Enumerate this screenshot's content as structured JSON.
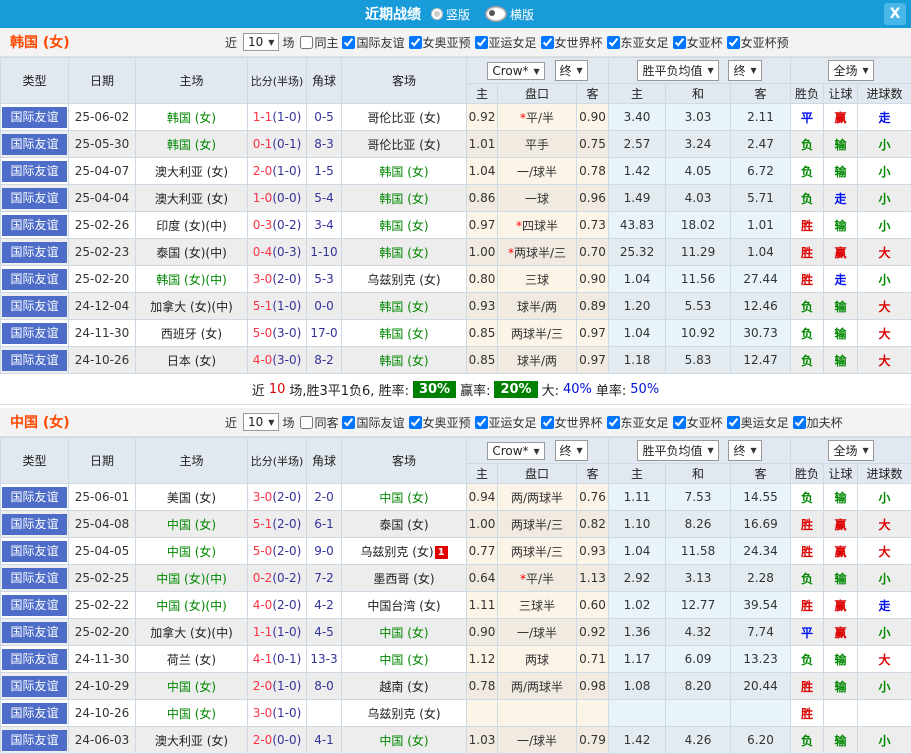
{
  "titlebar": {
    "title": "近期战绩",
    "radio_options": [
      {
        "label": "竖版",
        "selected": false
      },
      {
        "label": "横版",
        "selected": true
      }
    ],
    "close_label": "X"
  },
  "table_header": {
    "type": "类型",
    "date": "日期",
    "home": "主场",
    "score": "比分(半场)",
    "corner": "角球",
    "away": "客场",
    "odds_dropdown": "Crow*",
    "odds_final": "终",
    "avg_dropdown": "胜平负均值",
    "avg_final": "终",
    "full_dropdown": "全场",
    "sub": {
      "home_odd": "主",
      "handicap": "盘口",
      "away_odd": "客",
      "avg_home": "主",
      "avg_draw": "和",
      "avg_away": "客",
      "result": "胜负",
      "handicap_result": "让球",
      "goals": "进球数"
    }
  },
  "sections": [
    {
      "team_title": "韩国 (女)",
      "team_key": "韩国 (女)",
      "near_label": "近",
      "games": "10",
      "games_unit": "场",
      "same_label": "同主",
      "same_checked": false,
      "filters": [
        "国际友谊",
        "女奥亚预",
        "亚运女足",
        "女世界杯",
        "东亚女足",
        "女亚杯",
        "女亚杯预"
      ],
      "rows": [
        {
          "type": "国际友谊",
          "date": "25-06-02",
          "home": "韩国 (女)",
          "score": "1-1",
          "half": "(1-0)",
          "corner": "0-5",
          "away": "哥伦比亚 (女)",
          "badge": "",
          "oh": "0.92",
          "star": "*",
          "hand": "平/半",
          "oa": "0.90",
          "ah": "3.40",
          "ad": "3.03",
          "aa": "2.11",
          "r1": "平",
          "r2": "赢",
          "r3": "走"
        },
        {
          "type": "国际友谊",
          "date": "25-05-30",
          "home": "韩国 (女)",
          "score": "0-1",
          "half": "(0-1)",
          "corner": "8-3",
          "away": "哥伦比亚 (女)",
          "badge": "",
          "oh": "1.01",
          "star": "",
          "hand": "平手",
          "oa": "0.75",
          "ah": "2.57",
          "ad": "3.24",
          "aa": "2.47",
          "r1": "负",
          "r2": "输",
          "r3": "小"
        },
        {
          "type": "国际友谊",
          "date": "25-04-07",
          "home": "澳大利亚 (女)",
          "score": "2-0",
          "half": "(1-0)",
          "corner": "1-5",
          "away": "韩国 (女)",
          "badge": "",
          "oh": "1.04",
          "star": "",
          "hand": "一/球半",
          "oa": "0.78",
          "ah": "1.42",
          "ad": "4.05",
          "aa": "6.72",
          "r1": "负",
          "r2": "输",
          "r3": "小"
        },
        {
          "type": "国际友谊",
          "date": "25-04-04",
          "home": "澳大利亚 (女)",
          "score": "1-0",
          "half": "(0-0)",
          "corner": "5-4",
          "away": "韩国 (女)",
          "badge": "",
          "oh": "0.86",
          "star": "",
          "hand": "一球",
          "oa": "0.96",
          "ah": "1.49",
          "ad": "4.03",
          "aa": "5.71",
          "r1": "负",
          "r2": "走",
          "r3": "小"
        },
        {
          "type": "国际友谊",
          "date": "25-02-26",
          "home": "印度 (女)(中)",
          "score": "0-3",
          "half": "(0-2)",
          "corner": "3-4",
          "away": "韩国 (女)",
          "badge": "",
          "oh": "0.97",
          "star": "*",
          "hand": "四球半",
          "oa": "0.73",
          "ah": "43.83",
          "ad": "18.02",
          "aa": "1.01",
          "r1": "胜",
          "r2": "输",
          "r3": "小"
        },
        {
          "type": "国际友谊",
          "date": "25-02-23",
          "home": "泰国 (女)(中)",
          "score": "0-4",
          "half": "(0-3)",
          "corner": "1-10",
          "away": "韩国 (女)",
          "badge": "",
          "oh": "1.00",
          "star": "*",
          "hand": "两球半/三",
          "oa": "0.70",
          "ah": "25.32",
          "ad": "11.29",
          "aa": "1.04",
          "r1": "胜",
          "r2": "赢",
          "r3": "大"
        },
        {
          "type": "国际友谊",
          "date": "25-02-20",
          "home": "韩国 (女)(中)",
          "score": "3-0",
          "half": "(2-0)",
          "corner": "5-3",
          "away": "乌兹别克 (女)",
          "badge": "",
          "oh": "0.80",
          "star": "",
          "hand": "三球",
          "oa": "0.90",
          "ah": "1.04",
          "ad": "11.56",
          "aa": "27.44",
          "r1": "胜",
          "r2": "走",
          "r3": "小"
        },
        {
          "type": "国际友谊",
          "date": "24-12-04",
          "home": "加拿大 (女)(中)",
          "score": "5-1",
          "half": "(1-0)",
          "corner": "0-0",
          "away": "韩国 (女)",
          "badge": "",
          "oh": "0.93",
          "star": "",
          "hand": "球半/两",
          "oa": "0.89",
          "ah": "1.20",
          "ad": "5.53",
          "aa": "12.46",
          "r1": "负",
          "r2": "输",
          "r3": "大"
        },
        {
          "type": "国际友谊",
          "date": "24-11-30",
          "home": "西班牙 (女)",
          "score": "5-0",
          "half": "(3-0)",
          "corner": "17-0",
          "away": "韩国 (女)",
          "badge": "",
          "oh": "0.85",
          "star": "",
          "hand": "两球半/三",
          "oa": "0.97",
          "ah": "1.04",
          "ad": "10.92",
          "aa": "30.73",
          "r1": "负",
          "r2": "输",
          "r3": "大"
        },
        {
          "type": "国际友谊",
          "date": "24-10-26",
          "home": "日本 (女)",
          "score": "4-0",
          "half": "(3-0)",
          "corner": "8-2",
          "away": "韩国 (女)",
          "badge": "",
          "oh": "0.85",
          "star": "",
          "hand": "球半/两",
          "oa": "0.97",
          "ah": "1.18",
          "ad": "5.83",
          "aa": "12.47",
          "r1": "负",
          "r2": "输",
          "r3": "大"
        }
      ],
      "summary": {
        "prefix": "近",
        "count": "10",
        "mid": "场,胜3平1负6, 胜率:",
        "rate1": "30%",
        "label2": "赢率:",
        "rate2": "20%",
        "label3": "大:",
        "rate3": "40%",
        "label4": "单率:",
        "rate4": "50%"
      }
    },
    {
      "team_title": "中国 (女)",
      "team_key": "中国 (女)",
      "near_label": "近",
      "games": "10",
      "games_unit": "场",
      "same_label": "同客",
      "same_checked": false,
      "filters": [
        "国际友谊",
        "女奥亚预",
        "亚运女足",
        "女世界杯",
        "东亚女足",
        "女亚杯",
        "奥运女足",
        "加夫杯"
      ],
      "rows": [
        {
          "type": "国际友谊",
          "date": "25-06-01",
          "home": "美国 (女)",
          "score": "3-0",
          "half": "(2-0)",
          "corner": "2-0",
          "away": "中国 (女)",
          "badge": "",
          "oh": "0.94",
          "star": "",
          "hand": "两/两球半",
          "oa": "0.76",
          "ah": "1.11",
          "ad": "7.53",
          "aa": "14.55",
          "r1": "负",
          "r2": "输",
          "r3": "小"
        },
        {
          "type": "国际友谊",
          "date": "25-04-08",
          "home": "中国 (女)",
          "score": "5-1",
          "half": "(2-0)",
          "corner": "6-1",
          "away": "泰国 (女)",
          "badge": "",
          "oh": "1.00",
          "star": "",
          "hand": "两球半/三",
          "oa": "0.82",
          "ah": "1.10",
          "ad": "8.26",
          "aa": "16.69",
          "r1": "胜",
          "r2": "赢",
          "r3": "大"
        },
        {
          "type": "国际友谊",
          "date": "25-04-05",
          "home": "中国 (女)",
          "score": "5-0",
          "half": "(2-0)",
          "corner": "9-0",
          "away": "乌兹别克 (女)",
          "badge": "1",
          "oh": "0.77",
          "star": "",
          "hand": "两球半/三",
          "oa": "0.93",
          "ah": "1.04",
          "ad": "11.58",
          "aa": "24.34",
          "r1": "胜",
          "r2": "赢",
          "r3": "大"
        },
        {
          "type": "国际友谊",
          "date": "25-02-25",
          "home": "中国 (女)(中)",
          "score": "0-2",
          "half": "(0-2)",
          "corner": "7-2",
          "away": "墨西哥 (女)",
          "badge": "",
          "oh": "0.64",
          "star": "*",
          "hand": "平/半",
          "oa": "1.13",
          "ah": "2.92",
          "ad": "3.13",
          "aa": "2.28",
          "r1": "负",
          "r2": "输",
          "r3": "小"
        },
        {
          "type": "国际友谊",
          "date": "25-02-22",
          "home": "中国 (女)(中)",
          "score": "4-0",
          "half": "(2-0)",
          "corner": "4-2",
          "away": "中国台湾 (女)",
          "badge": "",
          "oh": "1.11",
          "star": "",
          "hand": "三球半",
          "oa": "0.60",
          "ah": "1.02",
          "ad": "12.77",
          "aa": "39.54",
          "r1": "胜",
          "r2": "赢",
          "r3": "走"
        },
        {
          "type": "国际友谊",
          "date": "25-02-20",
          "home": "加拿大 (女)(中)",
          "score": "1-1",
          "half": "(1-0)",
          "corner": "4-5",
          "away": "中国 (女)",
          "badge": "",
          "oh": "0.90",
          "star": "",
          "hand": "一/球半",
          "oa": "0.92",
          "ah": "1.36",
          "ad": "4.32",
          "aa": "7.74",
          "r1": "平",
          "r2": "赢",
          "r3": "小"
        },
        {
          "type": "国际友谊",
          "date": "24-11-30",
          "home": "荷兰 (女)",
          "score": "4-1",
          "half": "(0-1)",
          "corner": "13-3",
          "away": "中国 (女)",
          "badge": "",
          "oh": "1.12",
          "star": "",
          "hand": "两球",
          "oa": "0.71",
          "ah": "1.17",
          "ad": "6.09",
          "aa": "13.23",
          "r1": "负",
          "r2": "输",
          "r3": "大"
        },
        {
          "type": "国际友谊",
          "date": "24-10-29",
          "home": "中国 (女)",
          "score": "2-0",
          "half": "(1-0)",
          "corner": "8-0",
          "away": "越南 (女)",
          "badge": "",
          "oh": "0.78",
          "star": "",
          "hand": "两/两球半",
          "oa": "0.98",
          "ah": "1.08",
          "ad": "8.20",
          "aa": "20.44",
          "r1": "胜",
          "r2": "输",
          "r3": "小"
        },
        {
          "type": "国际友谊",
          "date": "24-10-26",
          "home": "中国 (女)",
          "score": "3-0",
          "half": "(1-0)",
          "corner": "",
          "away": "乌兹别克 (女)",
          "badge": "",
          "oh": "",
          "star": "",
          "hand": "",
          "oa": "",
          "ah": "",
          "ad": "",
          "aa": "",
          "r1": "胜",
          "r2": "",
          "r3": ""
        },
        {
          "type": "国际友谊",
          "date": "24-06-03",
          "home": "澳大利亚 (女)",
          "score": "2-0",
          "half": "(0-0)",
          "corner": "4-1",
          "away": "中国 (女)",
          "badge": "",
          "oh": "1.03",
          "star": "",
          "hand": "一/球半",
          "oa": "0.79",
          "ah": "1.42",
          "ad": "4.26",
          "aa": "6.20",
          "r1": "负",
          "r2": "输",
          "r3": "小"
        }
      ],
      "summary": null
    }
  ]
}
